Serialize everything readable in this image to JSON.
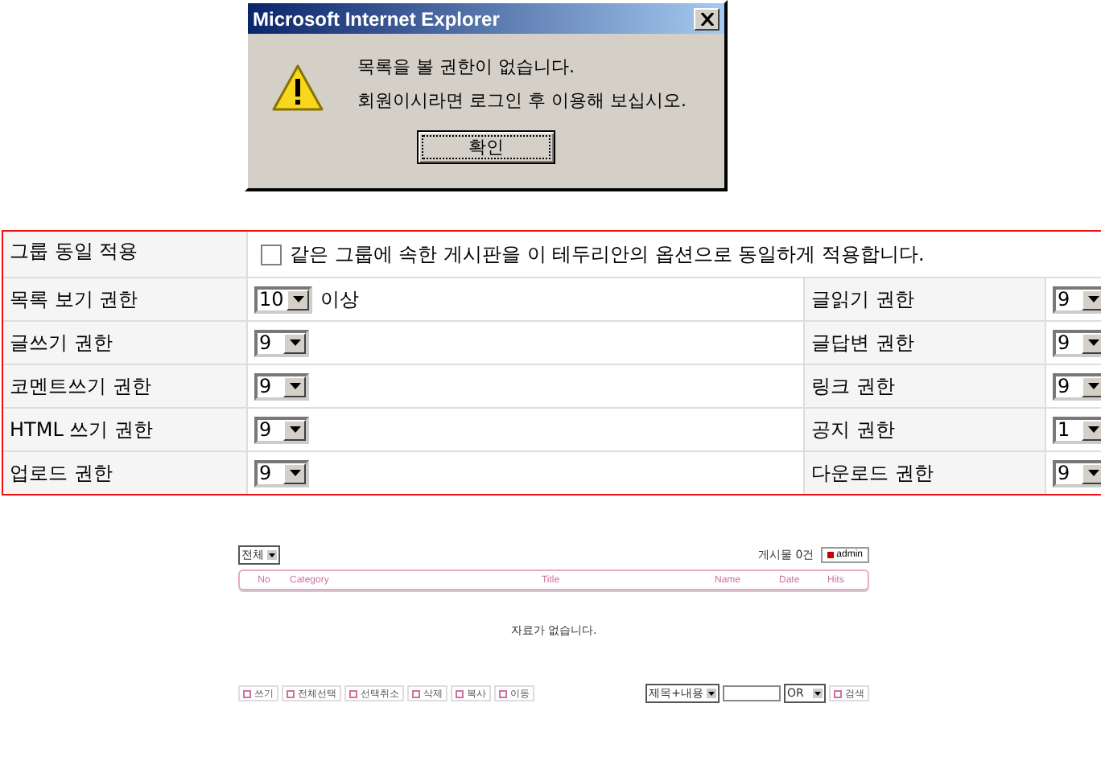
{
  "dialog": {
    "title": "Microsoft Internet Explorer",
    "messages": [
      "목록을 볼 권한이 없습니다.",
      "회원이시라면 로그인 후 이용해 보십시오."
    ],
    "button": "확인"
  },
  "permissions": {
    "group": {
      "label": "그룹 동일 적용",
      "checked": false,
      "text": "같은 그룹에 속한 게시판을 이 테두리안의 옵션으로 동일하게 적용합니다."
    },
    "rows": [
      {
        "left": {
          "label": "목록 보기 권한",
          "value": "10",
          "suffix": "이상"
        },
        "right": {
          "label": "글읽기 권한",
          "value": "9"
        }
      },
      {
        "left": {
          "label": "글쓰기 권한",
          "value": "9"
        },
        "right": {
          "label": "글답변 권한",
          "value": "9"
        }
      },
      {
        "left": {
          "label": "코멘트쓰기 권한",
          "value": "9"
        },
        "right": {
          "label": "링크 권한",
          "value": "9"
        }
      },
      {
        "left": {
          "label": "HTML 쓰기 권한",
          "value": "9"
        },
        "right": {
          "label": "공지 권한",
          "value": "1"
        }
      },
      {
        "left": {
          "label": "업로드 권한",
          "value": "9"
        },
        "right": {
          "label": "다운로드 권한",
          "value": "9"
        }
      }
    ]
  },
  "board": {
    "category": "전체",
    "count": "게시물 0건",
    "admin": "admin",
    "columns": [
      "No",
      "Category",
      "Title",
      "Name",
      "Date",
      "Hits"
    ],
    "empty": "자료가 없습니다.",
    "actions": [
      "쓰기",
      "전체선택",
      "선택취소",
      "삭제",
      "복사",
      "이동"
    ],
    "search_field": "제목+내용",
    "operator": "OR",
    "search_button": "검색"
  }
}
